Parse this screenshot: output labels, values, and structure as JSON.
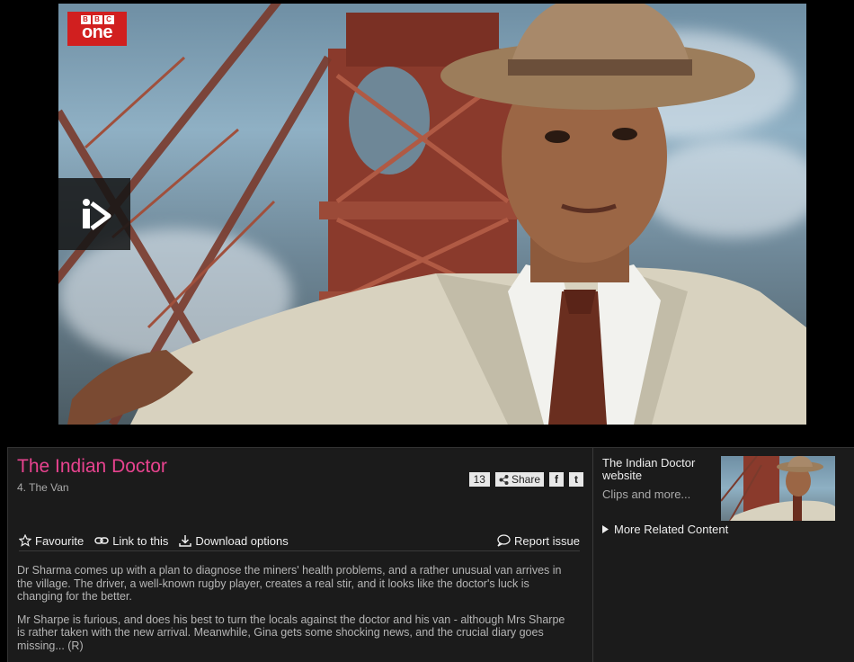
{
  "player": {
    "channel_logo_top": "BBC",
    "channel_logo_bottom": "one",
    "logo_letters": [
      "B",
      "B",
      "C"
    ],
    "play_icon": "iplayer-play-icon"
  },
  "programme": {
    "title": "The Indian Doctor",
    "episode": "4. The Van"
  },
  "share": {
    "count": "13",
    "label": "Share",
    "facebook_glyph": "f",
    "twitter_glyph": "t"
  },
  "toolbar": {
    "favourite": "Favourite",
    "link": "Link to this",
    "download": "Download options",
    "report": "Report issue"
  },
  "description": [
    "Dr Sharma comes up with a plan to diagnose the miners' health problems, and a rather unusual van arrives in the village. The driver, a well-known rugby player, creates a real stir, and it looks like the doctor's luck is changing for the better.",
    "Mr Sharpe is furious, and does his best to turn the locals against the doctor and his van - although Mrs Sharpe is rather taken with the new arrival. Meanwhile, Gina gets some shocking news, and the crucial diary goes missing... (R)"
  ],
  "sidebar": {
    "website_title": "The Indian Doctor website",
    "clips": "Clips and more...",
    "more_related": "More Related Content"
  },
  "colors": {
    "title_pink": "#e8438f",
    "bbc_red": "#d11f1f",
    "panel_bg": "#1b1b1b"
  }
}
